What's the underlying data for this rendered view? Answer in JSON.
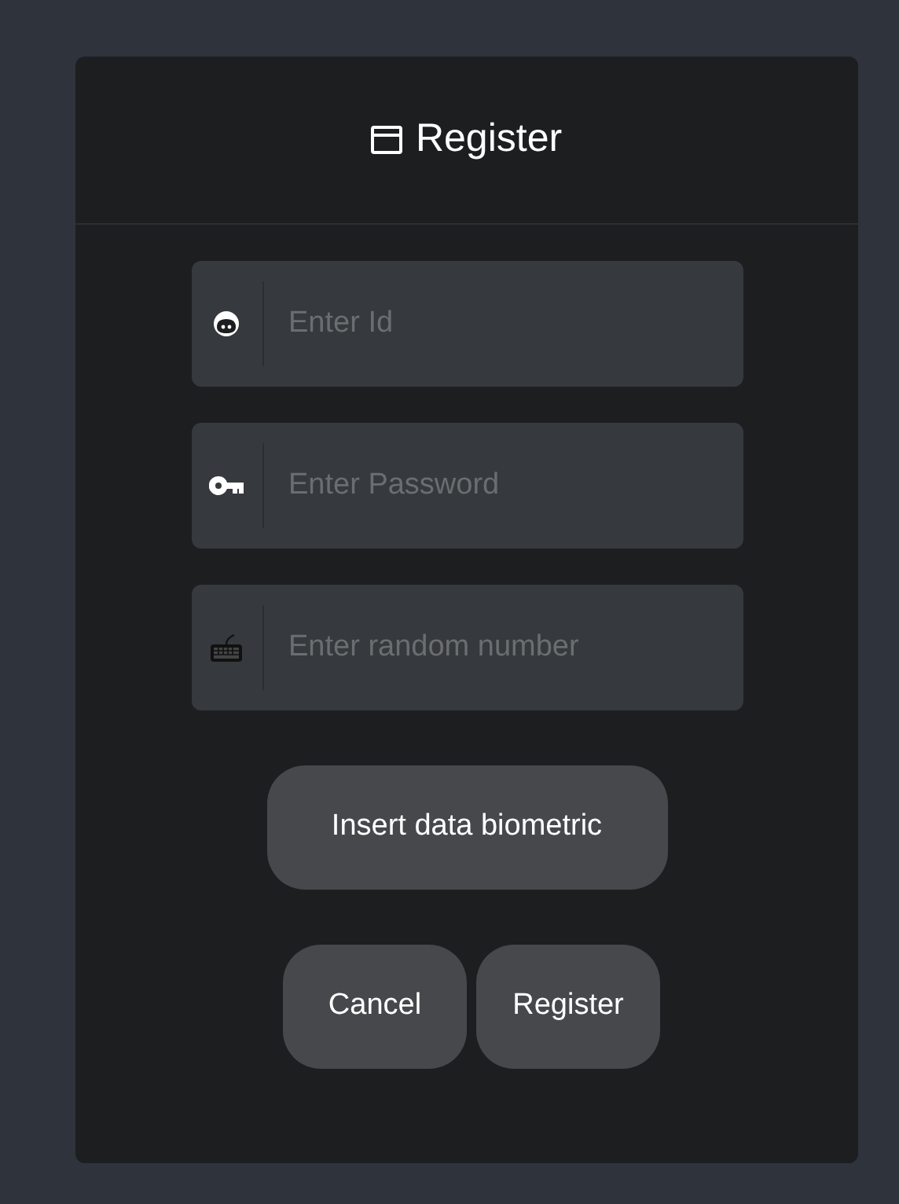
{
  "card": {
    "title": "Register"
  },
  "fields": [
    {
      "kind": "face",
      "placeholder": "Enter Id"
    },
    {
      "kind": "key",
      "placeholder": "Enter Password"
    },
    {
      "kind": "keyboard",
      "placeholder": "Enter random number"
    }
  ],
  "biometric_button": "Insert data biometric",
  "buttons": [
    "Cancel",
    "Register"
  ]
}
